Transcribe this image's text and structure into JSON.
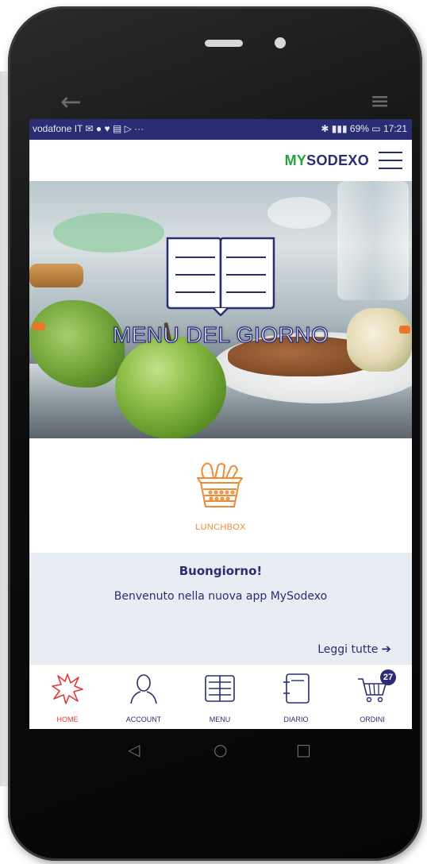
{
  "status_bar": {
    "left_text": "vodafone IT ✉ ● ♥ ▤ ▷ ···",
    "battery": "69%",
    "time": "17:21"
  },
  "app_bar": {
    "logo_part1": "MY",
    "logo_part2": "SODEXO"
  },
  "hero": {
    "title": "MENU DEL GIORNO"
  },
  "lunchbox": {
    "label": "LUNCHBOX"
  },
  "greeting": {
    "title": "Buongiorno!",
    "text": "Benvenuto nella nuova app MySodexo",
    "read_all": "Leggi tutte",
    "read_all_arrow": "➔"
  },
  "bottom_nav": {
    "items": [
      {
        "label": "HOME",
        "icon": "home-star-icon",
        "active": true
      },
      {
        "label": "ACCOUNT",
        "icon": "account-icon",
        "active": false
      },
      {
        "label": "MENU",
        "icon": "menu-book-icon",
        "active": false
      },
      {
        "label": "DIARIO",
        "icon": "diary-icon",
        "active": false
      },
      {
        "label": "ORDINI",
        "icon": "cart-icon",
        "active": false,
        "badge": "27"
      }
    ]
  },
  "colors": {
    "brand_navy": "#2b2d74",
    "brand_green": "#27a33b",
    "lunchbox_orange": "#ef8b34",
    "active_red": "#e23a3a",
    "greeting_bg": "#e8edf4"
  }
}
